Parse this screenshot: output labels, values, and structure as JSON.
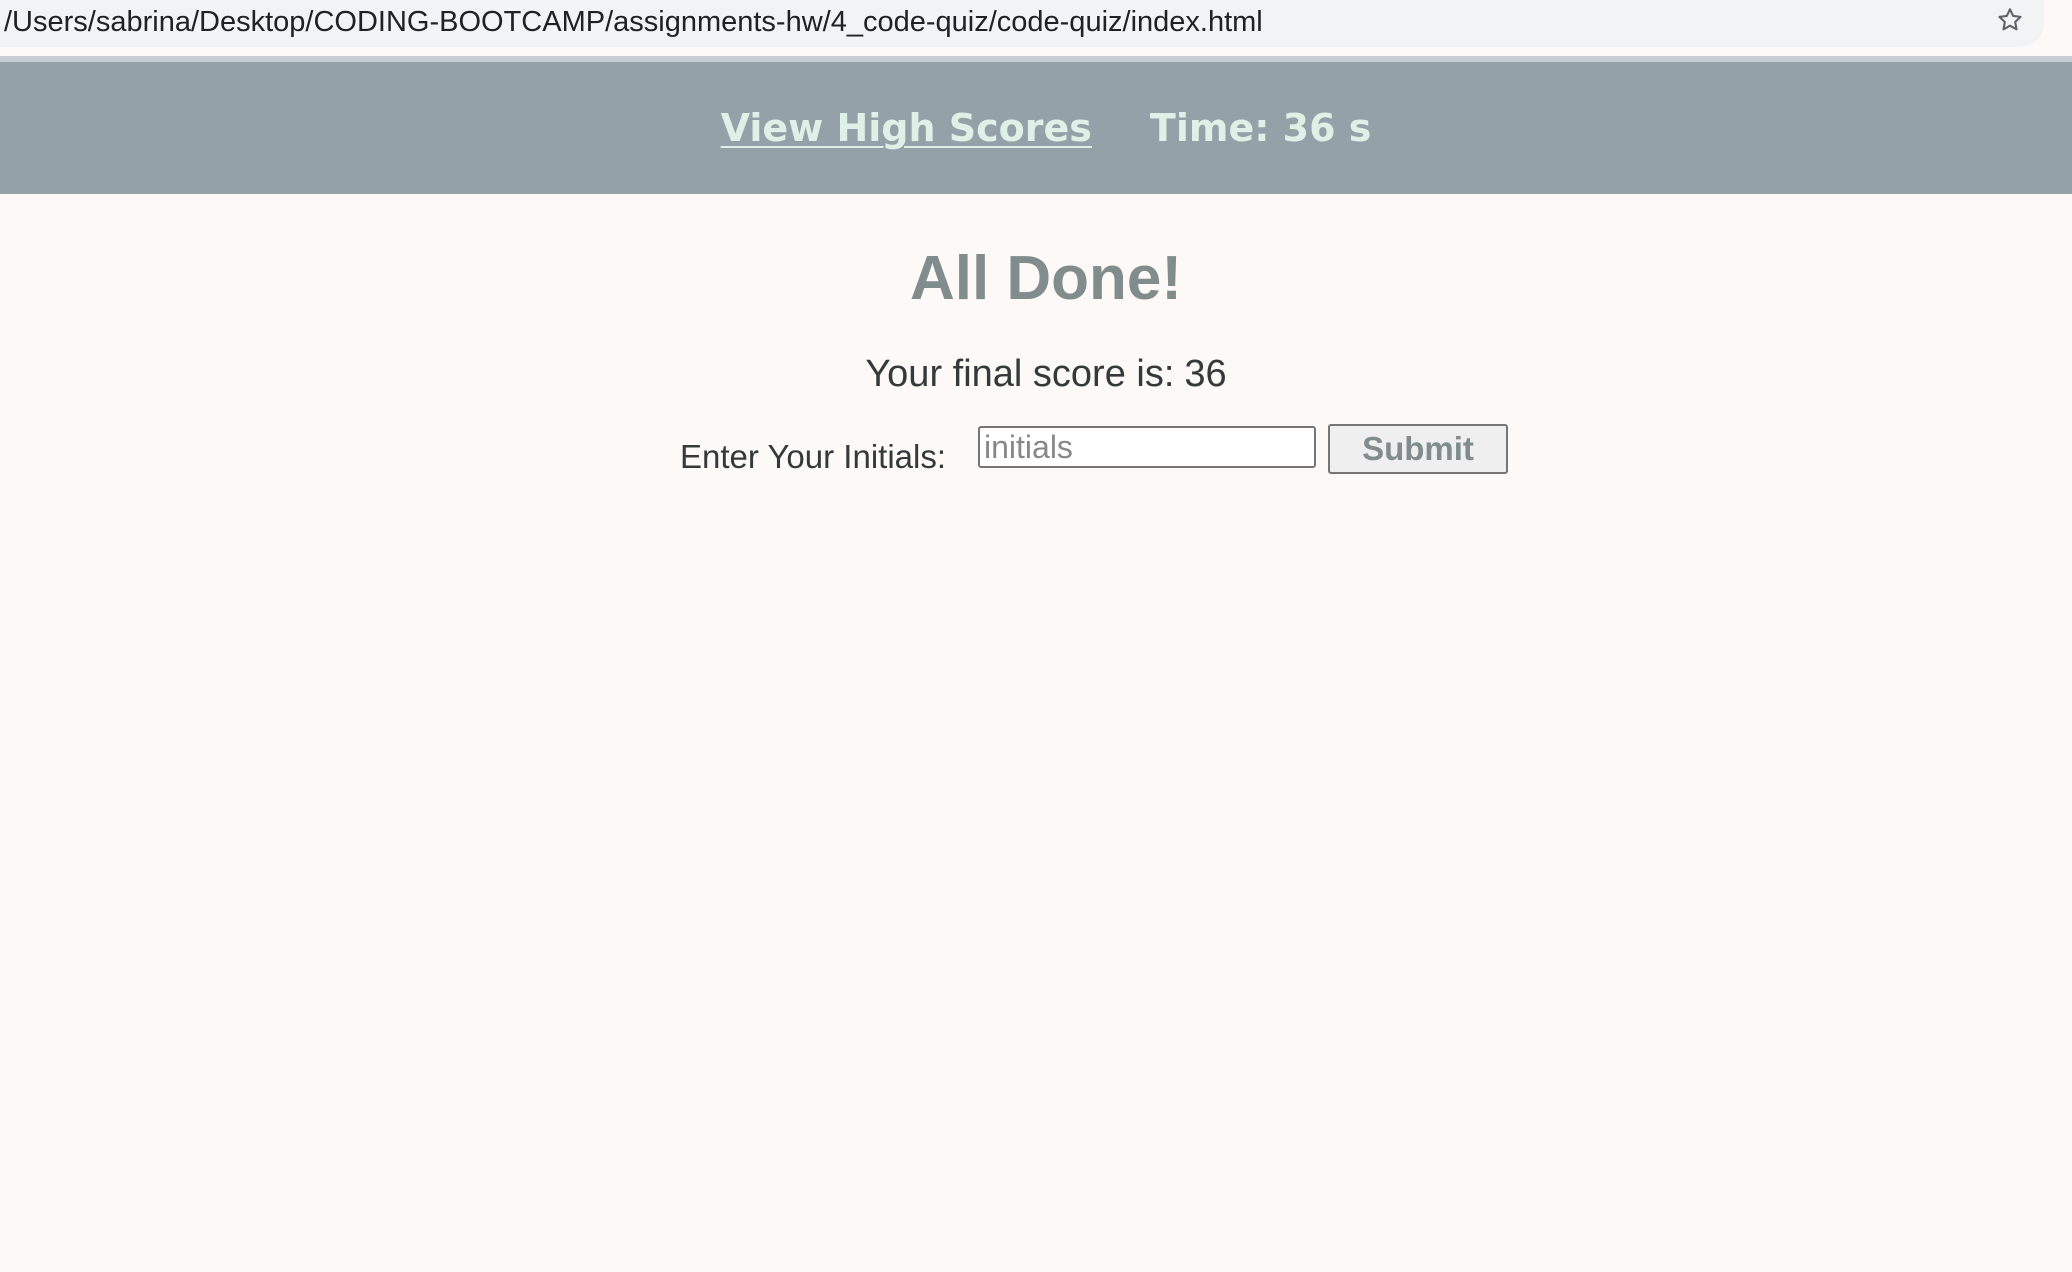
{
  "browser": {
    "url": "/Users/sabrina/Desktop/CODING-BOOTCAMP/assignments-hw/4_code-quiz/code-quiz/index.html",
    "bookmark_icon": "star-icon"
  },
  "header": {
    "high_scores_link": "View High Scores",
    "timer_text": "Time: 36 s"
  },
  "main": {
    "title": "All Done!",
    "score_label": "Your final score is:",
    "score_value": "36",
    "initials_label": "Enter Your Initials:",
    "initials_placeholder": "initials",
    "initials_value": "",
    "submit_label": "Submit"
  },
  "colors": {
    "header_bg": "#95a1a9",
    "header_text": "#dff0e6",
    "page_bg": "#fdf9f7",
    "title": "#818c8c"
  }
}
